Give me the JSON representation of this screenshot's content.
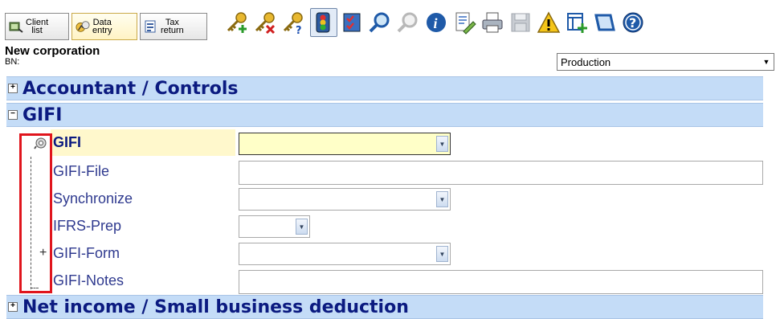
{
  "toolbar": {
    "tabs": [
      {
        "line1": "Client",
        "line2": "list",
        "icon": "client-list-icon"
      },
      {
        "line1": "Data",
        "line2": "entry",
        "icon": "data-entry-icon"
      },
      {
        "line1": "Tax",
        "line2": "return",
        "icon": "tax-return-icon"
      }
    ],
    "tools": [
      "add-key-icon",
      "remove-key-icon",
      "key-help-icon",
      "traffic-light-icon",
      "checklist-icon",
      "search-icon",
      "search-disabled-icon",
      "info-icon",
      "edit-document-icon",
      "print-icon",
      "save-icon",
      "warning-icon",
      "add-form-icon",
      "bookmark-icon",
      "help-icon"
    ]
  },
  "header": {
    "corporation": "New corporation",
    "bn_label": "BN:",
    "mode_select": "Production"
  },
  "sections": {
    "accountant": "Accountant / Controls",
    "gifi": "GIFI",
    "net_income": "Net income / Small business deduction"
  },
  "gifi_fields": {
    "gifi": "GIFI",
    "gifi_file": "GIFI-File",
    "synchronize": "Synchronize",
    "ifrs_prep": "IFRS-Prep",
    "gifi_form": "GIFI-Form",
    "gifi_notes": "GIFI-Notes"
  },
  "colors": {
    "section_bg": "#c4dcf7",
    "section_text": "#0b1a80",
    "highlight_border": "#e0151d",
    "active_field": "#ffffc8"
  }
}
